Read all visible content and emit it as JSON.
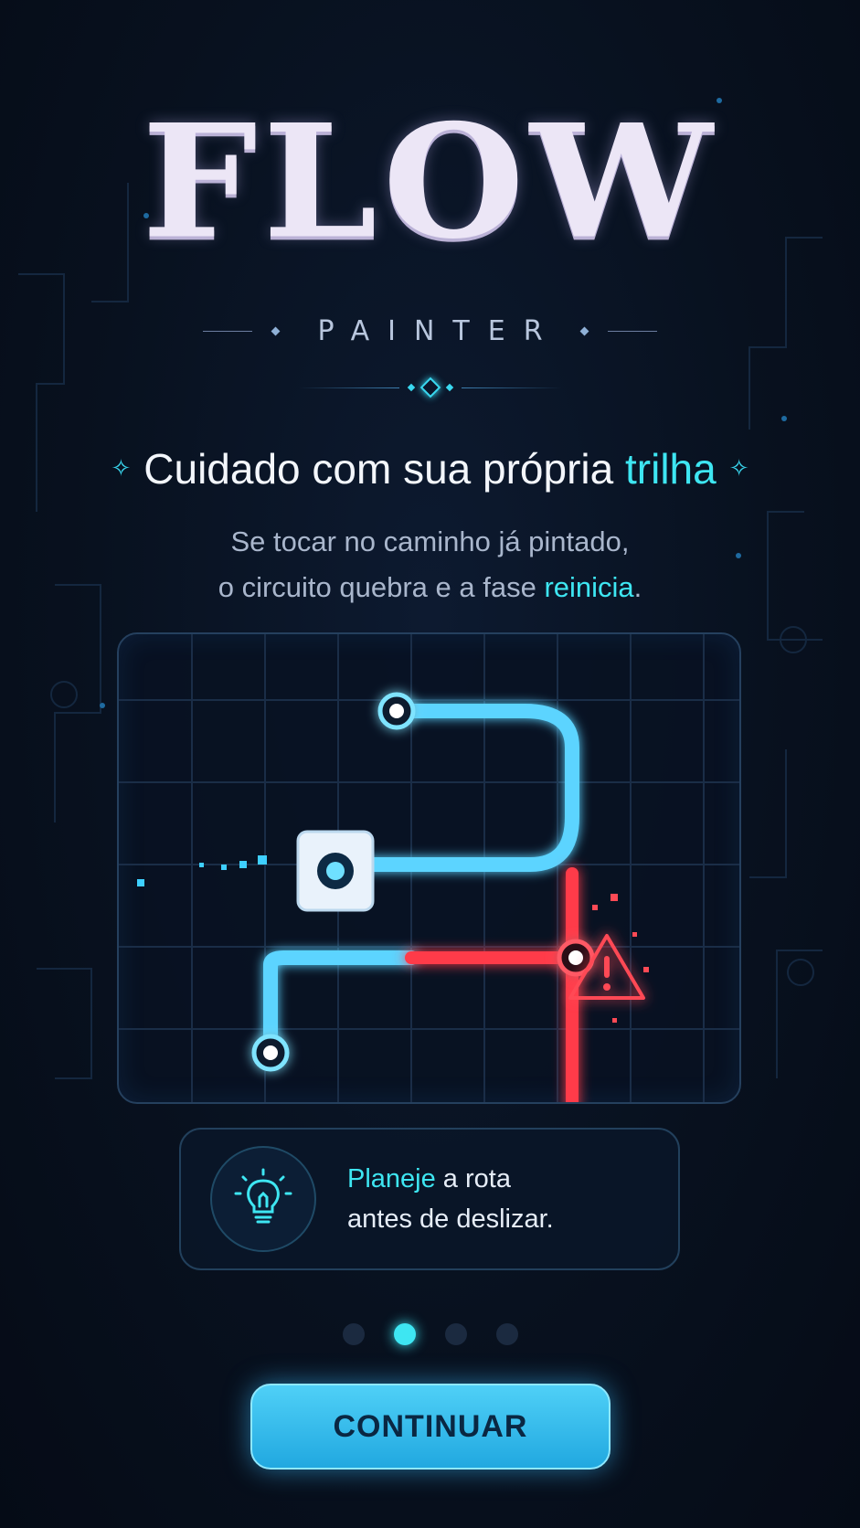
{
  "logo": {
    "title": "FLOW",
    "subtitle": "PAINTER"
  },
  "headline": {
    "prefix": "Cuidado com sua própria ",
    "accent": "trilha"
  },
  "body": {
    "line1": "Se tocar no caminho já pintado,",
    "line2_prefix": "o circuito quebra e a fase ",
    "line2_accent": "reinicia",
    "line2_suffix": "."
  },
  "tip": {
    "accent": "Planeje",
    "line1_rest": " a rota",
    "line2": "antes de deslizar.",
    "icon": "lightbulb-icon"
  },
  "pagination": {
    "total": 4,
    "active_index": 1
  },
  "cta": {
    "label": "CONTINUAR"
  },
  "colors": {
    "accent": "#3ee6f2",
    "path": "#5cd4ff",
    "danger": "#ff3b4a",
    "button": "#2bb4ea"
  }
}
